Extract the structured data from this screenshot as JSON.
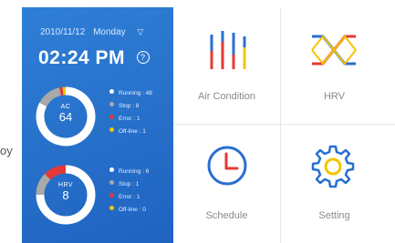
{
  "left_edge_text": "oy",
  "header": {
    "date": "2010/11/12",
    "weekday": "Monday",
    "time": "02:24 PM",
    "wifi_icon": "wifi-icon",
    "help_icon_glyph": "?"
  },
  "colors": {
    "panel_blue": "#2a75d0",
    "running": "#ffffff",
    "stop": "#a9a9a9",
    "error": "#e53935",
    "offline": "#f5c400",
    "icon_blue": "#2a6fd0",
    "icon_red": "#e53935",
    "icon_yellow": "#f5c400"
  },
  "chart_data": [
    {
      "type": "pie",
      "title": "AC",
      "center_value": "64",
      "categories": [
        "Running",
        "Stop",
        "Error",
        "Off-line"
      ],
      "values": [
        48,
        8,
        1,
        1
      ],
      "legend_labels": [
        "Running : 48",
        "Stop : 8",
        "Error : 1",
        "Off-line : 1"
      ]
    },
    {
      "type": "pie",
      "title": "HRV",
      "center_value": "8",
      "categories": [
        "Running",
        "Stop",
        "Error",
        "Off-line"
      ],
      "values": [
        6,
        1,
        1,
        0
      ],
      "legend_labels": [
        "Running : 6",
        "Stop : 1",
        "Error : 1",
        "Off-line : 0"
      ]
    }
  ],
  "tiles": [
    {
      "label": "Air Condition",
      "icon": "air-condition-icon"
    },
    {
      "label": "HRV",
      "icon": "hrv-icon"
    },
    {
      "label": "Schedule",
      "icon": "schedule-icon"
    },
    {
      "label": "Setting",
      "icon": "setting-icon"
    }
  ]
}
